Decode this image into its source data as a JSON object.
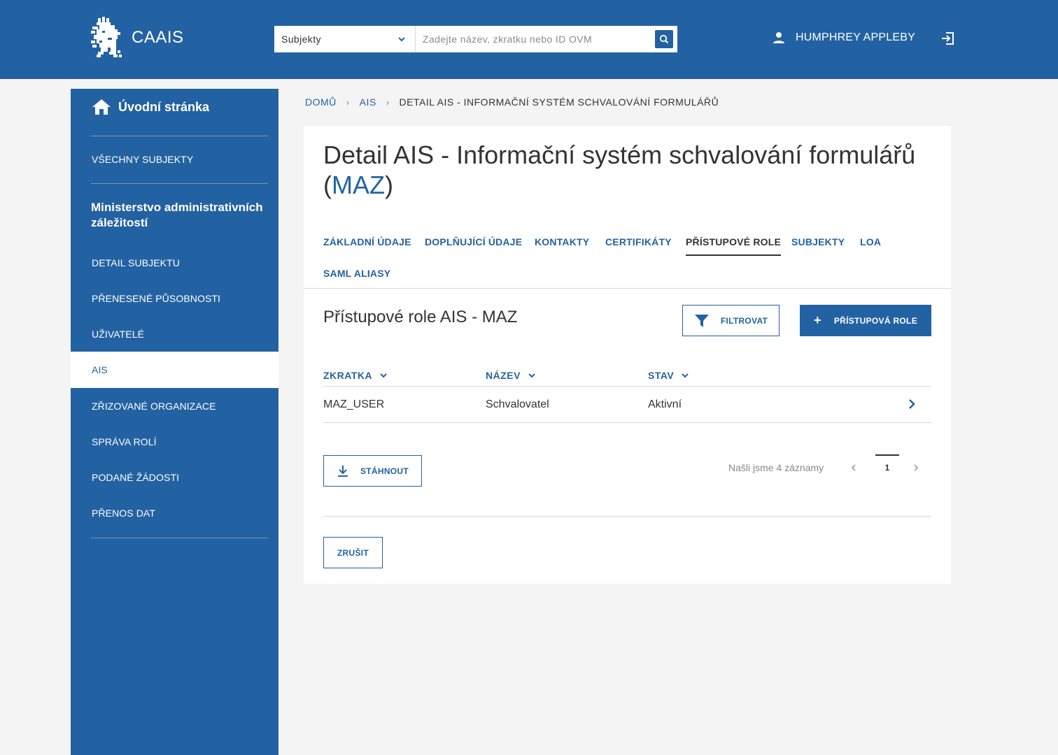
{
  "app": {
    "name": "CAAIS"
  },
  "search": {
    "scope": "Subjekty",
    "placeholder": "Zadejte název, zkratku nebo ID OVM"
  },
  "user": {
    "name": "HUMPHREY APPLEBY"
  },
  "sidebar": {
    "home": "Úvodní stránka",
    "all_subjects": "VŠECHNY SUBJEKTY",
    "org_name": "Ministerstvo administrativních záležitostí",
    "items": [
      {
        "label": "DETAIL SUBJEKTU"
      },
      {
        "label": "PŘENESENÉ PŮSOBNOSTI"
      },
      {
        "label": "UŽIVATELÉ"
      },
      {
        "label": "AIS",
        "active": true
      },
      {
        "label": "ZŘIZOVANÉ ORGANIZACE"
      },
      {
        "label": "SPRÁVA ROLÍ"
      },
      {
        "label": "PODANÉ ŽÁDOSTI"
      },
      {
        "label": "PŘENOS DAT"
      }
    ]
  },
  "breadcrumb": {
    "home": "DOMŮ",
    "ais": "AIS",
    "current": "DETAIL AIS - INFORMAČNÍ SYSTÉM SCHVALOVÁNÍ FORMULÁŘŮ"
  },
  "page": {
    "title": "Detail AIS - Informační systém schvalování formulářů",
    "title_code": "MAZ"
  },
  "tabs": [
    {
      "label": "ZÁKLADNÍ ÚDAJE"
    },
    {
      "label": "DOPLŇUJÍCÍ ÚDAJE"
    },
    {
      "label": "KONTAKTY"
    },
    {
      "label": "CERTIFIKÁTY"
    },
    {
      "label": "PŘÍSTUPOVÉ ROLE",
      "active": true
    },
    {
      "label": "SUBJEKTY"
    },
    {
      "label": "LOA"
    },
    {
      "label": "SAML ALIASY"
    }
  ],
  "section": {
    "title": "Přístupové role AIS - MAZ",
    "filter_label": "FILTROVAT",
    "add_label": "PŘÍSTUPOVÁ ROLE"
  },
  "table": {
    "headers": [
      "ZKRATKA",
      "NÁZEV",
      "STAV"
    ],
    "rows": [
      [
        "MAZ_USER",
        "Schvalovatel",
        "Aktivní"
      ]
    ]
  },
  "footer": {
    "download_label": "STÁHNOUT",
    "count_text": "Našli jsme 4 záznamy",
    "current_page": "1",
    "cancel_label": "ZRUŠIT"
  },
  "colors": {
    "brand": "#2362a2",
    "background": "#f4f4f4",
    "text": "#333333",
    "muted": "#888888"
  }
}
